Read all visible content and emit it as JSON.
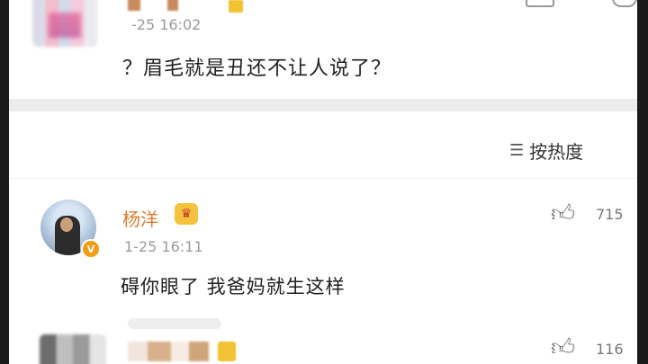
{
  "top_comment": {
    "time": "-25 16:02",
    "text": "？眉毛就是丑还不让人说了？"
  },
  "sort": {
    "icon": "sort-lines-icon",
    "label": "按热度"
  },
  "main_comment": {
    "username": "杨洋",
    "time": "1-25 16:11",
    "text": "碍你眼了 我爸妈就生这样",
    "likes": "715",
    "verified_icon": "v-badge-icon",
    "crown_icon": "crown-icon",
    "vip_glyph": "V"
  },
  "bottom_comment": {
    "likes": "116"
  },
  "colors": {
    "username": "#e07a2e",
    "timestamp": "#9a9a9a",
    "divider": "#ececec"
  }
}
